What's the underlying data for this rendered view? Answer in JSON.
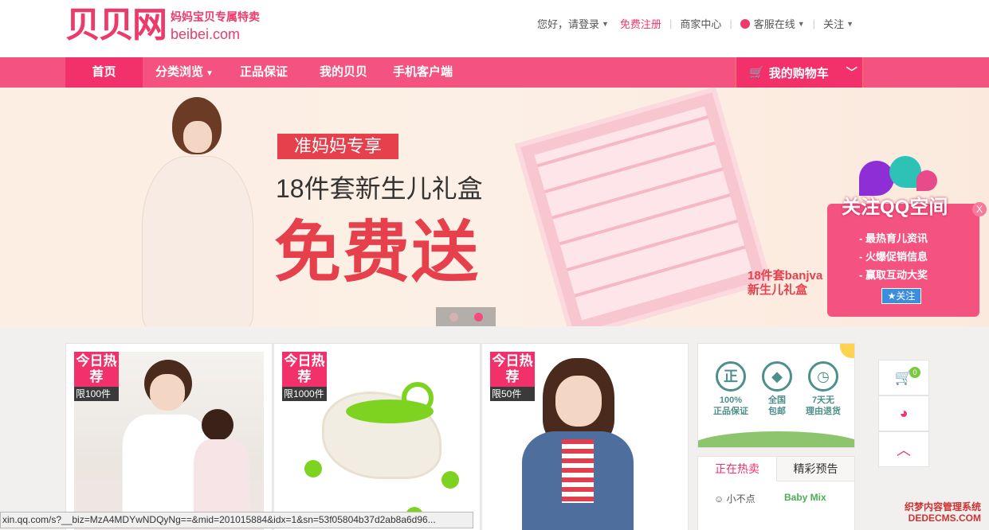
{
  "header": {
    "logo_mark": "贝贝网",
    "slogan": "妈妈宝贝专属特卖",
    "domain": "beibei.com",
    "greeting": "您好，",
    "login": "请登录",
    "register": "免费注册",
    "merchant": "商家中心",
    "service": "客服在线",
    "follow": "关注"
  },
  "nav": {
    "home": "首页",
    "categories": "分类浏览",
    "genuine": "正品保证",
    "my_beibei": "我的贝贝",
    "mobile": "手机客户端",
    "cart": "我的购物车"
  },
  "banner": {
    "tag": "准妈妈专享",
    "subtitle": "18件套新生儿礼盒",
    "headline": "免费送",
    "product_label_1": "18件套banjva",
    "product_label_2": "新生儿礼盒",
    "active_slide": 2,
    "slide_count": 2
  },
  "qq_widget": {
    "title": "关注QQ空间",
    "close": "X",
    "items": [
      "- 最热育儿资讯",
      "- 火爆促销信息",
      "- 赢取互动大奖"
    ],
    "follow_button": "关注"
  },
  "products": [
    {
      "hot": "今日热荐",
      "limit": "限100件"
    },
    {
      "hot": "今日热荐",
      "limit": "限1000件"
    },
    {
      "hot": "今日热荐",
      "limit": "限50件"
    }
  ],
  "guarantees": [
    {
      "icon_char": "正",
      "line1": "100%",
      "line2": "正品保证"
    },
    {
      "icon_char": "◆",
      "line1": "全国",
      "line2": "包邮"
    },
    {
      "icon_char": "◷",
      "line1": "7天无",
      "line2": "理由退货"
    }
  ],
  "tabs": {
    "active": "正在热卖",
    "next": "精彩预告",
    "brand1": "小不点",
    "brand2": "Baby Mix"
  },
  "sidebar": {
    "cart_count": "0"
  },
  "statusbar": {
    "url": "xin.qq.com/s?__biz=MzA4MDYwNDQyNg==&mid=201015884&idx=1&sn=53f05804b37d2ab8a6d96..."
  },
  "watermark": {
    "line1": "织梦内容管理系统",
    "line2": "DEDECMS.COM"
  },
  "colors": {
    "brand": "#f2306a",
    "nav": "#f5537f"
  }
}
